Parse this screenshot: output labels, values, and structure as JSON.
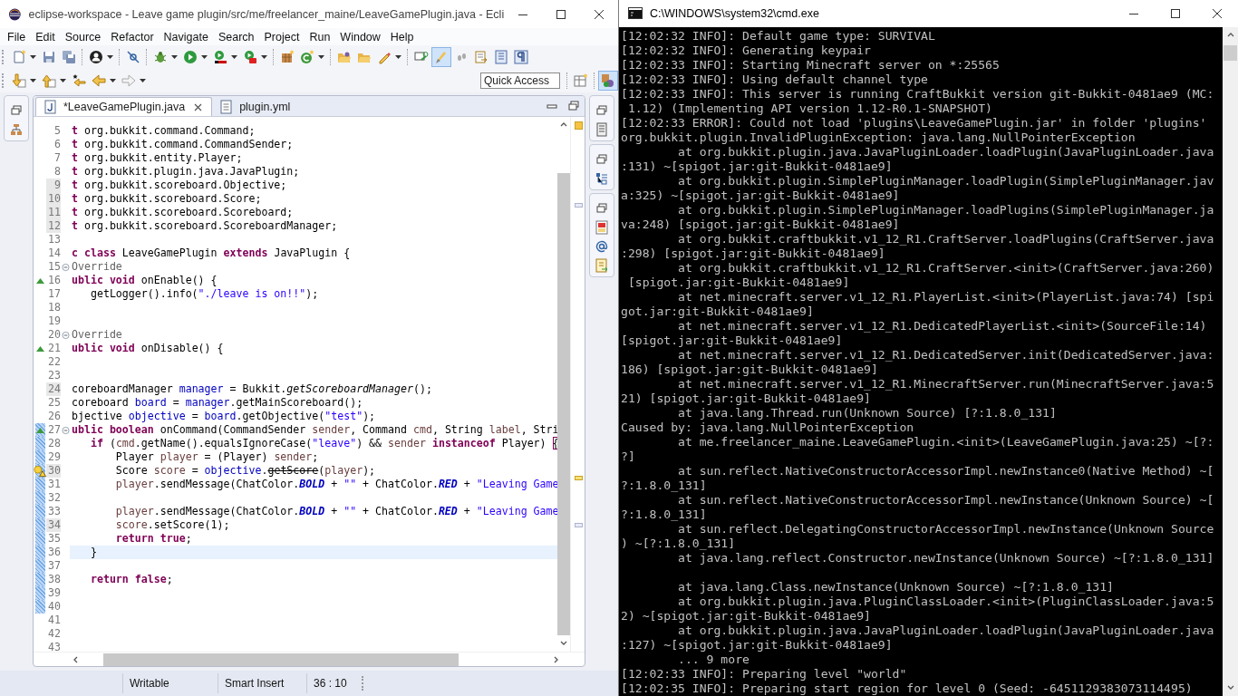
{
  "eclipse": {
    "title": "eclipse-workspace - Leave game plugin/src/me/freelancer_maine/LeaveGamePlugin.java - Ecli",
    "menu": [
      "File",
      "Edit",
      "Source",
      "Refactor",
      "Navigate",
      "Search",
      "Project",
      "Run",
      "Window",
      "Help"
    ],
    "quick_access": {
      "placeholder": "Quick Access"
    },
    "editor_tabs": [
      {
        "label": "*LeaveGamePlugin.java",
        "selected": true,
        "kind": "java"
      },
      {
        "label": "plugin.yml",
        "selected": false,
        "kind": "text"
      }
    ],
    "code_lines": [
      {
        "number": "5",
        "tokens": [
          {
            "kind": "keyword",
            "text": "t"
          },
          {
            "text": " org.bukkit.command.Command;"
          }
        ]
      },
      {
        "number": "6",
        "tokens": [
          {
            "kind": "keyword",
            "text": "t"
          },
          {
            "text": " org.bukkit.command.CommandSender;"
          }
        ]
      },
      {
        "number": "7",
        "tokens": [
          {
            "kind": "keyword",
            "text": "t"
          },
          {
            "text": " org.bukkit.entity.Player;"
          }
        ]
      },
      {
        "number": "8",
        "tokens": [
          {
            "kind": "keyword",
            "text": "t"
          },
          {
            "text": " org.bukkit.plugin.java.JavaPlugin;"
          }
        ]
      },
      {
        "number": "9",
        "changed": true,
        "tokens": [
          {
            "kind": "keyword",
            "text": "t"
          },
          {
            "text": " org.bukkit.scoreboard.Objective;"
          }
        ]
      },
      {
        "number": "10",
        "changed": true,
        "tokens": [
          {
            "kind": "keyword",
            "text": "t"
          },
          {
            "text": " org.bukkit.scoreboard.Score;"
          }
        ]
      },
      {
        "number": "11",
        "changed": true,
        "tokens": [
          {
            "kind": "keyword",
            "text": "t"
          },
          {
            "text": " org.bukkit.scoreboard.Scoreboard;"
          }
        ]
      },
      {
        "number": "12",
        "changed": true,
        "tokens": [
          {
            "kind": "keyword",
            "text": "t"
          },
          {
            "text": " org.bukkit.scoreboard.ScoreboardManager;"
          }
        ]
      },
      {
        "number": "13"
      },
      {
        "number": "14",
        "tokens": [
          {
            "kind": "keyword",
            "text": "c class"
          },
          {
            "text": " LeaveGamePlugin "
          },
          {
            "kind": "keyword",
            "text": "extends"
          },
          {
            "text": " JavaPlugin {"
          }
        ]
      },
      {
        "number": "15",
        "fold": true,
        "tokens": [
          {
            "kind": "annotation",
            "text": "Override"
          }
        ]
      },
      {
        "number": "16",
        "override": true,
        "tokens": [
          {
            "kind": "keyword",
            "text": "ublic void"
          },
          {
            "text": " onEnable() {"
          }
        ]
      },
      {
        "number": "17",
        "tokens": [
          {
            "text": "   getLogger().info("
          },
          {
            "kind": "string",
            "text": "\"./leave is on!!\""
          },
          {
            "text": ");"
          }
        ]
      },
      {
        "number": "18"
      },
      {
        "number": "19"
      },
      {
        "number": "20",
        "fold": true,
        "tokens": [
          {
            "kind": "annotation",
            "text": "Override"
          }
        ]
      },
      {
        "number": "21",
        "override": true,
        "tokens": [
          {
            "kind": "keyword",
            "text": "ublic void"
          },
          {
            "text": " onDisable() {"
          }
        ]
      },
      {
        "number": "22"
      },
      {
        "number": "23"
      },
      {
        "number": "24",
        "changed": true,
        "tokens": [
          {
            "text": "coreboardManager "
          },
          {
            "kind": "field",
            "text": "manager"
          },
          {
            "text": " = Bukkit."
          },
          {
            "kind": "static_method",
            "text": "getScoreboardManager"
          },
          {
            "text": "();"
          }
        ]
      },
      {
        "number": "25",
        "tokens": [
          {
            "text": "coreboard "
          },
          {
            "kind": "field",
            "text": "board"
          },
          {
            "text": " = "
          },
          {
            "kind": "field",
            "text": "manager"
          },
          {
            "text": ".getMainScoreboard();"
          }
        ]
      },
      {
        "number": "26",
        "tokens": [
          {
            "text": "bjective "
          },
          {
            "kind": "field",
            "text": "objective"
          },
          {
            "text": " = "
          },
          {
            "kind": "field",
            "text": "board"
          },
          {
            "text": ".getObjective("
          },
          {
            "kind": "string",
            "text": "\"test\""
          },
          {
            "text": ");"
          }
        ]
      },
      {
        "number": "27",
        "override": true,
        "fold": true,
        "quick_diff": true,
        "tokens": [
          {
            "kind": "keyword",
            "text": "ublic boolean"
          },
          {
            "text": " onCommand(CommandSender "
          },
          {
            "kind": "local",
            "text": "sender"
          },
          {
            "text": ", Command "
          },
          {
            "kind": "local",
            "text": "cmd"
          },
          {
            "text": ", String "
          },
          {
            "kind": "local",
            "text": "label"
          },
          {
            "text": ", Stri"
          }
        ]
      },
      {
        "number": "28",
        "quick_diff": true,
        "tokens": [
          {
            "kind": "keyword",
            "text": "   if"
          },
          {
            "text": " ("
          },
          {
            "kind": "local",
            "text": "cmd"
          },
          {
            "text": ".getName().equalsIgnoreCase("
          },
          {
            "kind": "string",
            "text": "\"leave\""
          },
          {
            "text": ") && "
          },
          {
            "kind": "local",
            "text": "sender"
          },
          {
            "kind": "keyword",
            "text": " instanceof"
          },
          {
            "text": " Player) "
          },
          {
            "kind": "bracket",
            "text": "{"
          }
        ]
      },
      {
        "number": "29",
        "quick_diff": true,
        "tokens": [
          {
            "text": "       Player "
          },
          {
            "kind": "local",
            "text": "player"
          },
          {
            "text": " = (Player) "
          },
          {
            "kind": "local",
            "text": "sender"
          },
          {
            "text": ";"
          }
        ]
      },
      {
        "number": "30",
        "quick_diff": true,
        "changed": true,
        "warning": true,
        "tokens": [
          {
            "text": "       Score "
          },
          {
            "kind": "local",
            "text": "score"
          },
          {
            "text": " = "
          },
          {
            "kind": "field",
            "text": "objective"
          },
          {
            "text": "."
          },
          {
            "kind": "deprecated",
            "text": "getScore"
          },
          {
            "text": "("
          },
          {
            "kind": "local",
            "text": "player"
          },
          {
            "text": ");"
          }
        ]
      },
      {
        "number": "31",
        "quick_diff": true,
        "tokens": [
          {
            "kind": "local",
            "text": "       player"
          },
          {
            "text": ".sendMessage(ChatColor."
          },
          {
            "kind": "static_field",
            "text": "BOLD"
          },
          {
            "text": " + "
          },
          {
            "kind": "string",
            "text": "\"\""
          },
          {
            "text": " + ChatColor."
          },
          {
            "kind": "static_field",
            "text": "RED"
          },
          {
            "text": " + "
          },
          {
            "kind": "string",
            "text": "\"Leaving Game"
          }
        ]
      },
      {
        "number": "32",
        "quick_diff": true
      },
      {
        "number": "33",
        "quick_diff": true,
        "tokens": [
          {
            "kind": "local",
            "text": "       player"
          },
          {
            "text": ".sendMessage(ChatColor."
          },
          {
            "kind": "static_field",
            "text": "BOLD"
          },
          {
            "text": " + "
          },
          {
            "kind": "string",
            "text": "\"\""
          },
          {
            "text": " + ChatColor."
          },
          {
            "kind": "static_field",
            "text": "RED"
          },
          {
            "text": " + "
          },
          {
            "kind": "string",
            "text": "\"Leaving Game"
          }
        ]
      },
      {
        "number": "34",
        "quick_diff": true,
        "changed": true,
        "tokens": [
          {
            "kind": "local",
            "text": "       score"
          },
          {
            "text": ".setScore(1);"
          }
        ]
      },
      {
        "number": "35",
        "quick_diff": true,
        "tokens": [
          {
            "kind": "keyword",
            "text": "       return true"
          },
          {
            "text": ";"
          }
        ]
      },
      {
        "number": "36",
        "quick_diff": true,
        "current": true,
        "tokens": [
          {
            "text": "   }"
          }
        ]
      },
      {
        "number": "37",
        "quick_diff": true
      },
      {
        "number": "38",
        "quick_diff": true,
        "tokens": [
          {
            "kind": "keyword",
            "text": "   return false"
          },
          {
            "text": ";"
          }
        ]
      },
      {
        "number": "39",
        "quick_diff": true
      },
      {
        "number": "40",
        "quick_diff": true
      },
      {
        "number": "41"
      },
      {
        "number": "42"
      },
      {
        "number": "43"
      }
    ],
    "status_bar": [
      "Writable",
      "Smart Insert",
      "36 : 10"
    ]
  },
  "console": {
    "title": "C:\\WINDOWS\\system32\\cmd.exe",
    "lines": [
      {
        "text": "[12:02:32 INFO]: Default game type: SURVIVAL"
      },
      {
        "text": "[12:02:32 INFO]: Generating keypair"
      },
      {
        "text": "[12:02:33 INFO]: Starting Minecraft server on *:25565"
      },
      {
        "text": "[12:02:33 INFO]: Using default channel type"
      },
      {
        "text": "[12:02:33 INFO]: This server is running CraftBukkit version git-Bukkit-0481ae9 (MC:"
      },
      {
        "text": " 1.12) (Implementing API version 1.12-R0.1-SNAPSHOT)"
      },
      {
        "text": "[12:02:33 ERROR]: Could not load 'plugins\\LeaveGamePlugin.jar' in folder 'plugins'"
      },
      {
        "text": "org.bukkit.plugin.InvalidPluginException: java.lang.NullPointerException"
      },
      {
        "text": "        at org.bukkit.plugin.java.JavaPluginLoader.loadPlugin(JavaPluginLoader.java"
      },
      {
        "text": ":131) ~[spigot.jar:git-Bukkit-0481ae9]"
      },
      {
        "text": "        at org.bukkit.plugin.SimplePluginManager.loadPlugin(SimplePluginManager.jav"
      },
      {
        "text": "a:325) ~[spigot.jar:git-Bukkit-0481ae9]"
      },
      {
        "text": "        at org.bukkit.plugin.SimplePluginManager.loadPlugins(SimplePluginManager.ja"
      },
      {
        "text": "va:248) [spigot.jar:git-Bukkit-0481ae9]"
      },
      {
        "text": "        at org.bukkit.craftbukkit.v1_12_R1.CraftServer.loadPlugins(CraftServer.java"
      },
      {
        "text": ":298) [spigot.jar:git-Bukkit-0481ae9]"
      },
      {
        "text": "        at org.bukkit.craftbukkit.v1_12_R1.CraftServer.<init>(CraftServer.java:260)"
      },
      {
        "text": " [spigot.jar:git-Bukkit-0481ae9]"
      },
      {
        "text": "        at net.minecraft.server.v1_12_R1.PlayerList.<init>(PlayerList.java:74) [spi"
      },
      {
        "text": "got.jar:git-Bukkit-0481ae9]"
      },
      {
        "text": "        at net.minecraft.server.v1_12_R1.DedicatedPlayerList.<init>(SourceFile:14)"
      },
      {
        "text": "[spigot.jar:git-Bukkit-0481ae9]"
      },
      {
        "text": "        at net.minecraft.server.v1_12_R1.DedicatedServer.init(DedicatedServer.java:"
      },
      {
        "text": "186) [spigot.jar:git-Bukkit-0481ae9]"
      },
      {
        "text": "        at net.minecraft.server.v1_12_R1.MinecraftServer.run(MinecraftServer.java:5"
      },
      {
        "text": "21) [spigot.jar:git-Bukkit-0481ae9]"
      },
      {
        "text": "        at java.lang.Thread.run(Unknown Source) [?:1.8.0_131]"
      },
      {
        "text": "Caused by: java.lang.NullPointerException"
      },
      {
        "text": "        at me.freelancer_maine.LeaveGamePlugin.<init>(LeaveGamePlugin.java:25) ~[?:"
      },
      {
        "text": "?]"
      },
      {
        "text": "        at sun.reflect.NativeConstructorAccessorImpl.newInstance0(Native Method) ~["
      },
      {
        "text": "?:1.8.0_131]"
      },
      {
        "text": "        at sun.reflect.NativeConstructorAccessorImpl.newInstance(Unknown Source) ~["
      },
      {
        "text": "?:1.8.0_131]"
      },
      {
        "text": "        at sun.reflect.DelegatingConstructorAccessorImpl.newInstance(Unknown Source"
      },
      {
        "text": ") ~[?:1.8.0_131]"
      },
      {
        "text": "        at java.lang.reflect.Constructor.newInstance(Unknown Source) ~[?:1.8.0_131]",
        "blank_after": true
      },
      {
        "text": "        at java.lang.Class.newInstance(Unknown Source) ~[?:1.8.0_131]"
      },
      {
        "text": "        at org.bukkit.plugin.java.PluginClassLoader.<init>(PluginClassLoader.java:5"
      },
      {
        "text": "2) ~[spigot.jar:git-Bukkit-0481ae9]"
      },
      {
        "text": "        at org.bukkit.plugin.java.JavaPluginLoader.loadPlugin(JavaPluginLoader.java"
      },
      {
        "text": ":127) ~[spigot.jar:git-Bukkit-0481ae9]"
      },
      {
        "text": "        ... 9 more"
      },
      {
        "text": "[12:02:33 INFO]: Preparing level \"world\""
      },
      {
        "text": "[12:02:35 INFO]: Preparing start region for level 0 (Seed: -6451129383073114495)"
      }
    ]
  }
}
